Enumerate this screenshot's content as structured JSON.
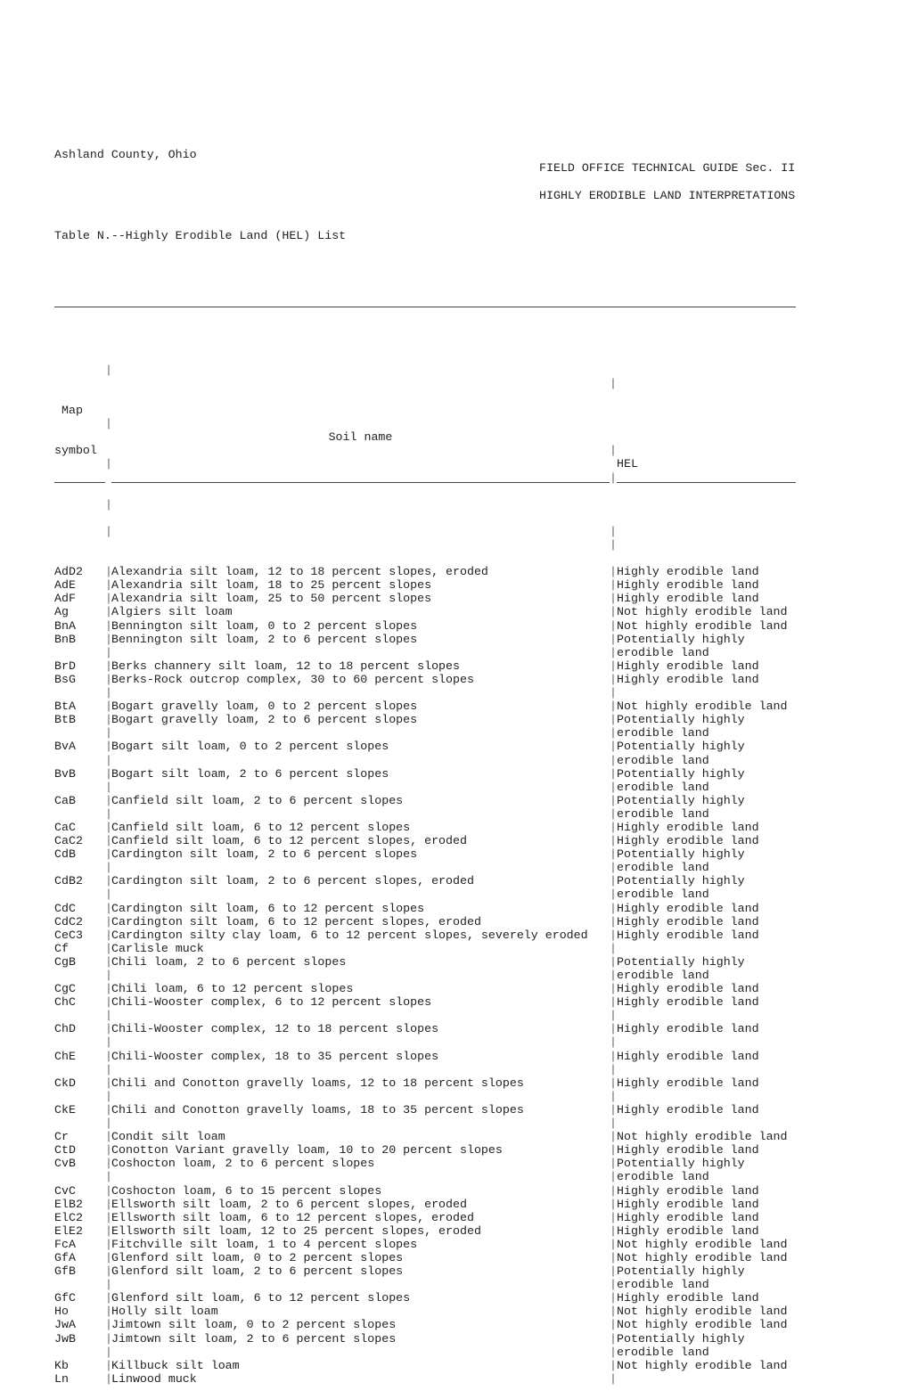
{
  "header": {
    "left_line1": "Ashland County, Ohio",
    "right_line1": "FIELD OFFICE TECHNICAL GUIDE Sec. II",
    "right_line2": "HIGHLY ERODIBLE LAND INTERPRETATIONS",
    "table_title": "Table N.--Highly Erodible Land (HEL) List"
  },
  "table": {
    "columns": {
      "map_symbol_line1": "Map",
      "map_symbol_line2": "symbol",
      "soil_name": "Soil name",
      "hel": "HEL"
    },
    "rows": [
      {
        "symbol": "AdD2",
        "name": "Alexandria silt loam, 12 to 18 percent slopes, eroded",
        "hel": [
          "Highly erodible land"
        ],
        "spacer": false
      },
      {
        "symbol": "AdE",
        "name": "Alexandria silt loam, 18 to 25 percent slopes",
        "hel": [
          "Highly erodible land"
        ],
        "spacer": false
      },
      {
        "symbol": "AdF",
        "name": "Alexandria silt loam, 25 to 50 percent slopes",
        "hel": [
          "Highly erodible land"
        ],
        "spacer": false
      },
      {
        "symbol": "Ag",
        "name": "Algiers silt loam",
        "hel": [
          "Not highly erodible land"
        ],
        "spacer": false
      },
      {
        "symbol": "BnA",
        "name": "Bennington silt loam, 0 to 2 percent slopes",
        "hel": [
          "Not highly erodible land"
        ],
        "spacer": false
      },
      {
        "symbol": "BnB",
        "name": "Bennington silt loam, 2 to 6 percent slopes",
        "hel": [
          "Potentially highly",
          "erodible land"
        ],
        "spacer": false
      },
      {
        "symbol": "BrD",
        "name": "Berks channery silt loam, 12 to 18 percent slopes",
        "hel": [
          "Highly erodible land"
        ],
        "spacer": false
      },
      {
        "symbol": "BsG",
        "name": "Berks-Rock outcrop complex, 30 to 60 percent slopes",
        "hel": [
          "Highly erodible land"
        ],
        "spacer": true
      },
      {
        "symbol": "BtA",
        "name": "Bogart gravelly loam, 0 to 2 percent slopes",
        "hel": [
          "Not highly erodible land"
        ],
        "spacer": false
      },
      {
        "symbol": "BtB",
        "name": "Bogart gravelly loam, 2 to 6 percent slopes",
        "hel": [
          "Potentially highly",
          "erodible land"
        ],
        "spacer": false
      },
      {
        "symbol": "BvA",
        "name": "Bogart silt loam, 0 to 2 percent slopes",
        "hel": [
          "Potentially highly",
          "erodible land"
        ],
        "spacer": false
      },
      {
        "symbol": "BvB",
        "name": "Bogart silt loam, 2 to 6 percent slopes",
        "hel": [
          "Potentially highly",
          "erodible land"
        ],
        "spacer": false
      },
      {
        "symbol": "CaB",
        "name": "Canfield silt loam, 2 to 6 percent slopes",
        "hel": [
          "Potentially highly",
          "erodible land"
        ],
        "spacer": false
      },
      {
        "symbol": "CaC",
        "name": "Canfield silt loam, 6 to 12 percent slopes",
        "hel": [
          "Highly erodible land"
        ],
        "spacer": false
      },
      {
        "symbol": "CaC2",
        "name": "Canfield silt loam, 6 to 12 percent slopes, eroded",
        "hel": [
          "Highly erodible land"
        ],
        "spacer": false
      },
      {
        "symbol": "CdB",
        "name": "Cardington silt loam, 2 to 6 percent slopes",
        "hel": [
          "Potentially highly",
          "erodible land"
        ],
        "spacer": false
      },
      {
        "symbol": "CdB2",
        "name": "Cardington silt loam, 2 to 6 percent slopes, eroded",
        "hel": [
          "Potentially highly",
          "erodible land"
        ],
        "spacer": false
      },
      {
        "symbol": "CdC",
        "name": "Cardington silt loam, 6 to 12 percent slopes",
        "hel": [
          "Highly erodible land"
        ],
        "spacer": false
      },
      {
        "symbol": "CdC2",
        "name": "Cardington silt loam, 6 to 12 percent slopes, eroded",
        "hel": [
          "Highly erodible land"
        ],
        "spacer": false
      },
      {
        "symbol": "CeC3",
        "name": "Cardington silty clay loam, 6 to 12 percent slopes, severely eroded",
        "hel": [
          "Highly erodible land"
        ],
        "spacer": false
      },
      {
        "symbol": "Cf",
        "name": "Carlisle muck",
        "hel": [
          ""
        ],
        "spacer": false
      },
      {
        "symbol": "CgB",
        "name": "Chili loam, 2 to 6 percent slopes",
        "hel": [
          "Potentially highly",
          "erodible land"
        ],
        "spacer": false
      },
      {
        "symbol": "CgC",
        "name": "Chili loam, 6 to 12 percent slopes",
        "hel": [
          "Highly erodible land"
        ],
        "spacer": false
      },
      {
        "symbol": "ChC",
        "name": "Chili-Wooster complex, 6 to 12 percent slopes",
        "hel": [
          "Highly erodible land"
        ],
        "spacer": true
      },
      {
        "symbol": "ChD",
        "name": "Chili-Wooster complex, 12 to 18 percent slopes",
        "hel": [
          "Highly erodible land"
        ],
        "spacer": true
      },
      {
        "symbol": "ChE",
        "name": "Chili-Wooster complex, 18 to 35 percent slopes",
        "hel": [
          "Highly erodible land"
        ],
        "spacer": true
      },
      {
        "symbol": "CkD",
        "name": "Chili and Conotton gravelly loams, 12 to 18 percent slopes",
        "hel": [
          "Highly erodible land"
        ],
        "spacer": true
      },
      {
        "symbol": "CkE",
        "name": "Chili and Conotton gravelly loams, 18 to 35 percent slopes",
        "hel": [
          "Highly erodible land"
        ],
        "spacer": true
      },
      {
        "symbol": "Cr",
        "name": "Condit silt loam",
        "hel": [
          "Not highly erodible land"
        ],
        "spacer": false
      },
      {
        "symbol": "CtD",
        "name": "Conotton Variant gravelly loam, 10 to 20 percent slopes",
        "hel": [
          "Highly erodible land"
        ],
        "spacer": false
      },
      {
        "symbol": "CvB",
        "name": "Coshocton loam, 2 to 6 percent slopes",
        "hel": [
          "Potentially highly",
          "erodible land"
        ],
        "spacer": false
      },
      {
        "symbol": "CvC",
        "name": "Coshocton loam, 6 to 15 percent slopes",
        "hel": [
          "Highly erodible land"
        ],
        "spacer": false
      },
      {
        "symbol": "ElB2",
        "name": "Ellsworth silt loam, 2 to 6 percent slopes, eroded",
        "hel": [
          "Highly erodible land"
        ],
        "spacer": false
      },
      {
        "symbol": "ElC2",
        "name": "Ellsworth silt loam, 6 to 12 percent slopes, eroded",
        "hel": [
          "Highly erodible land"
        ],
        "spacer": false
      },
      {
        "symbol": "ElE2",
        "name": "Ellsworth silt loam, 12 to 25 percent slopes, eroded",
        "hel": [
          "Highly erodible land"
        ],
        "spacer": false
      },
      {
        "symbol": "FcA",
        "name": "Fitchville silt loam, 1 to 4 percent slopes",
        "hel": [
          "Not highly erodible land"
        ],
        "spacer": false
      },
      {
        "symbol": "GfA",
        "name": "Glenford silt loam, 0 to 2 percent slopes",
        "hel": [
          "Not highly erodible land"
        ],
        "spacer": false
      },
      {
        "symbol": "GfB",
        "name": "Glenford silt loam, 2 to 6 percent slopes",
        "hel": [
          "Potentially highly",
          "erodible land"
        ],
        "spacer": false
      },
      {
        "symbol": "GfC",
        "name": "Glenford silt loam, 6 to 12 percent slopes",
        "hel": [
          "Highly erodible land"
        ],
        "spacer": false
      },
      {
        "symbol": "Ho",
        "name": "Holly silt loam",
        "hel": [
          "Not highly erodible land"
        ],
        "spacer": false
      },
      {
        "symbol": "JwA",
        "name": "Jimtown silt loam, 0 to 2 percent slopes",
        "hel": [
          "Not highly erodible land"
        ],
        "spacer": false
      },
      {
        "symbol": "JwB",
        "name": "Jimtown silt loam, 2 to 6 percent slopes",
        "hel": [
          "Potentially highly",
          "erodible land"
        ],
        "spacer": false
      },
      {
        "symbol": "Kb",
        "name": "Killbuck silt loam",
        "hel": [
          "Not highly erodible land"
        ],
        "spacer": false
      },
      {
        "symbol": "Ln",
        "name": "Linwood muck",
        "hel": [
          ""
        ],
        "spacer": false
      }
    ]
  },
  "glyphs": {
    "separator": "|"
  }
}
